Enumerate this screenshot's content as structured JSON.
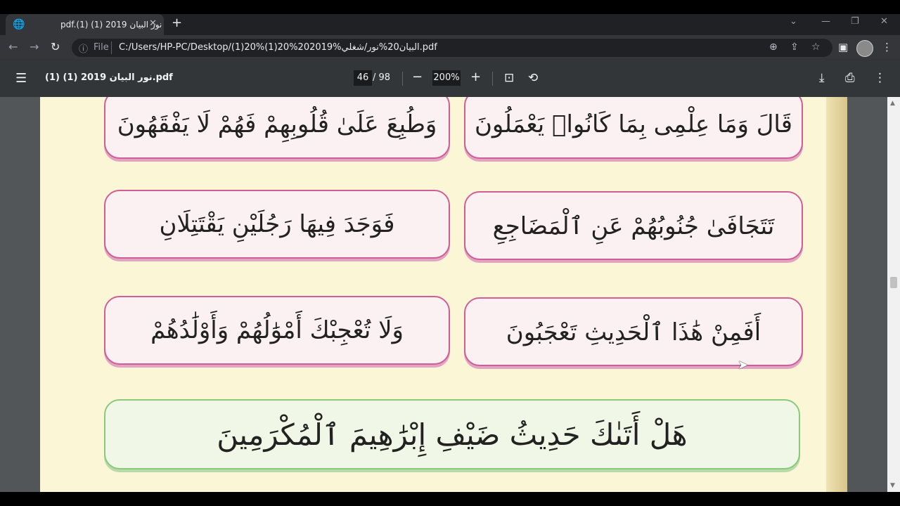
{
  "browser": {
    "tab_title": "pdf.(1) (1) نور البيان 2019",
    "new_tab": "+",
    "close_tab": "✕",
    "scheme_label": "File",
    "url": "C:/Users/HP-PC/Desktop/(1)20%(1)20%202019%البيان20%نور/شغلي.pdf"
  },
  "pdf_toolbar": {
    "doc_title": "نور البيان 2019 (1) (1).pdf",
    "page_current": "46",
    "page_total": "/ 98",
    "zoom": "200%"
  },
  "page": {
    "cards": [
      {
        "id": "row1-right",
        "text": "قَالَ وَمَا عِلْمِى بِمَا كَانُوا۟ يَعْمَلُونَ"
      },
      {
        "id": "row1-left",
        "text": "وَطُبِعَ عَلَىٰ قُلُوبِهِمْ فَهُمْ لَا يَفْقَهُونَ"
      },
      {
        "id": "row2-right",
        "text": "تَتَجَافَىٰ جُنُوبُهُمْ عَنِ ٱلْمَضَاجِعِ"
      },
      {
        "id": "row2-left",
        "text": "فَوَجَدَ فِيهَا رَجُلَيْنِ يَقْتَتِلَانِ"
      },
      {
        "id": "row3-right",
        "text": "أَفَمِنْ هَٰذَا ٱلْحَدِيثِ تَعْجَبُونَ"
      },
      {
        "id": "row3-left",
        "text": "وَلَا تُعْجِبْكَ أَمْوَٰلُهُمْ وَأَوْلَٰدُهُمْ"
      },
      {
        "id": "row4-wide",
        "text": "هَلْ أَتَىٰكَ حَدِيثُ ضَيْفِ إِبْرَٰهِيمَ ٱلْمُكْرَمِينَ"
      }
    ]
  },
  "colors": {
    "page_bg": "#fbf6d6",
    "pink_border": "#d05e95",
    "green_border": "#8bc879"
  },
  "icons": [
    "globe-icon",
    "back-icon",
    "forward-icon",
    "reload-icon",
    "info-icon",
    "zoom-icon",
    "share-icon",
    "star-icon",
    "sidepanel-icon",
    "menu-icon",
    "fit-page-icon",
    "rotate-icon",
    "download-icon",
    "print-icon",
    "more-icon"
  ]
}
